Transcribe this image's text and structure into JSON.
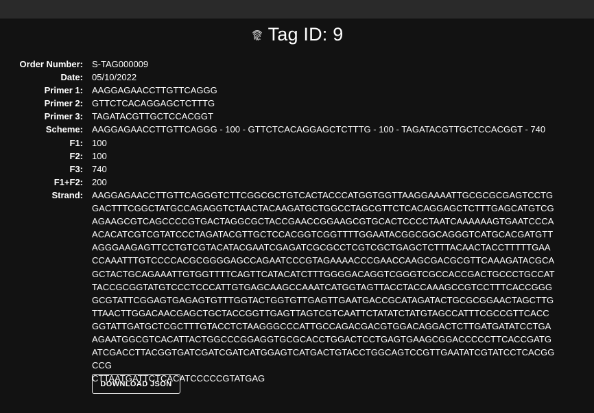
{
  "header": {
    "title": "Tag ID: 9",
    "icon": "fingerprint-icon"
  },
  "details": [
    {
      "key": "order_number",
      "label": "Order Number:",
      "value": "S-TAG000009"
    },
    {
      "key": "date",
      "label": "Date:",
      "value": "05/10/2022"
    },
    {
      "key": "primer_1",
      "label": "Primer 1:",
      "value": "AAGGAGAACCTTGTTCAGGG"
    },
    {
      "key": "primer_2",
      "label": "Primer 2:",
      "value": "GTTCTCACAGGAGCTCTTTG"
    },
    {
      "key": "primer_3",
      "label": "Primer 3:",
      "value": "TAGATACGTTGCTCCACGGT"
    },
    {
      "key": "scheme",
      "label": "Scheme:",
      "value": "AAGGAGAACCTTGTTCAGGG - 100 - GTTCTCACAGGAGCTCTTTG - 100 - TAGATACGTTGCTCCACGGT - 740"
    },
    {
      "key": "f1",
      "label": "F1:",
      "value": "100"
    },
    {
      "key": "f2",
      "label": "F2:",
      "value": "100"
    },
    {
      "key": "f3",
      "label": "F3:",
      "value": "740"
    },
    {
      "key": "f1_f2",
      "label": "F1+F2:",
      "value": "200"
    }
  ],
  "strand": {
    "label": "Strand:",
    "lines": [
      "AAGGAGAACCTTGTTCAGGGTCTTCGGCGCTGTCACTACCCATGGTGGTTAAGGAAAATTGCGCGCGAGTCCTG",
      "GACTTTCGGCTATGCCAGAGGTCTAACTACAAGATGCTGGCCTAGCGTTCTCACAGGAGCTCTTTGAGCATGTCG",
      "AGAAGCGTCAGCCCCGTGACTAGGCGCTACCGAACCGGAAGCGTGCACTCCCCTAATCAAAAAAGTGAATCCCA",
      "ACACATCGTCGTATCCCTAGATACGTTGCTCCACGGTCGGTTTTGGAATACGGCGGCAGGGTCATGCACGATGTT",
      "AGGGAAGAGTTCCTGTCGTACATACGAATCGAGATCGCGCCTCGTCGCTGAGCTCTTTACAACTACCTTTTTGAA",
      "CCAAATTTGTCCCCACGCGGGGAGCCAGAATCCCGTAGAAAACCCGAACCAAGCGACGCGTTCAAAGATACGCA",
      "GCTACTGCAGAAATTGTGGTTTTCAGTTCATACATCTTTGGGGACAGGTCGGGTCGCCACCGACTGCCCTGCCAT",
      "TACCGCGGTATGTCCCTCCCATTGTGAGCAAGCCAAATCATGGTAGTTACCTACCAAAGCCGTCCTTTCACCGGG",
      "GCGTATTCGGAGTGAGAGTGTTTGGTACTGGTGTTGAGTTGAATGACCGCATAGATACTGCGCGGAACTAGCTTG",
      "TTAACTTGGACAACGAGCTGCTACCGGTTGAGTTAGTCGTCAATTCTATATCTATGTAGCCATTTCGCCGTTCACC",
      "GGTATTGATGCTCGCTTTGTACCTCTAAGGGCCCATTGCCAGACGACGTGGACAGGACTCTTGATGATATCCTGA",
      "AGAATGGCGTCACATTACTGGCCCGGAGGTGCGCACCTGGACTCCTGAGTGAAGCGGACCCCCTTCACCGATG",
      "ATCGACCTTACGGTGATCGATCGATCATGGAGTCATGACTGTACCTGGCAGTCCGTTGAATATCGTATCCTCACGGCCG",
      "CTTAATGATTCTCACATCCCCCGTATGAG"
    ]
  },
  "actions": {
    "download_label": "DOWNLOAD JSON"
  }
}
